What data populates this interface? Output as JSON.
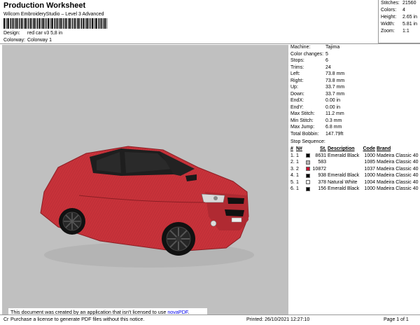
{
  "header": {
    "title": "Production Worksheet",
    "subtitle": "Wilcom EmbroideryStudio – Level 3 Advanced",
    "design_label": "Design:",
    "design_value": "red car v3 5,8 in",
    "colorway_label": "Colorway:",
    "colorway_value": "Colorway 1"
  },
  "summary": [
    {
      "k": "Stitches:",
      "v": "21560"
    },
    {
      "k": "Colors:",
      "v": "4"
    },
    {
      "k": "Height:",
      "v": "2.65 in"
    },
    {
      "k": "Width:",
      "v": "5.81 in"
    },
    {
      "k": "Zoom:",
      "v": "1:1"
    }
  ],
  "info": [
    {
      "k": "Machine:",
      "v": "Tajima"
    },
    {
      "k": "Color changes:",
      "v": "5"
    },
    {
      "k": "Stops:",
      "v": "6"
    },
    {
      "k": "Trims:",
      "v": "24"
    },
    {
      "k": "Left:",
      "v": "73.8 mm"
    },
    {
      "k": "Right:",
      "v": "73.8 mm"
    },
    {
      "k": "Up:",
      "v": "33.7 mm"
    },
    {
      "k": "Down:",
      "v": "33.7 mm"
    },
    {
      "k": "EndX:",
      "v": "0.00 in"
    },
    {
      "k": "EndY:",
      "v": "0.00 in"
    },
    {
      "k": "Max Stitch:",
      "v": "11.2 mm"
    },
    {
      "k": "Min Stitch:",
      "v": "0.3 mm"
    },
    {
      "k": "Max Jump:",
      "v": "6.8 mm"
    },
    {
      "k": "Total Bobbin:",
      "v": "147.79ft"
    }
  ],
  "stops": {
    "title": "Stop Sequence:",
    "headers": {
      "num": "#",
      "n": "N#",
      "st": "St.",
      "desc": "Description",
      "code": "Code",
      "brand": "Brand"
    },
    "rows": [
      {
        "num": "1.",
        "n": "1",
        "color": "#000000",
        "st": "8631",
        "desc": "Emerald Black",
        "code": "1000",
        "brand": "Madeira Classic 40"
      },
      {
        "num": "2.",
        "n": "1",
        "color": "#b4b4b4",
        "st": "583",
        "desc": "",
        "code": "1085",
        "brand": "Madeira Classic 40"
      },
      {
        "num": "3.",
        "n": "2",
        "color": "#c8102e",
        "st": "10872",
        "desc": "",
        "code": "1037",
        "brand": "Madeira Classic 40"
      },
      {
        "num": "4.",
        "n": "1",
        "color": "#000000",
        "st": "938",
        "desc": "Emerald Black",
        "code": "1000",
        "brand": "Madeira Classic 40"
      },
      {
        "num": "5.",
        "n": "1",
        "color": "#f0f0f0",
        "st": "378",
        "desc": "Natural White",
        "code": "1004",
        "brand": "Madeira Classic 40"
      },
      {
        "num": "6.",
        "n": "1",
        "color": "#000000",
        "st": "156",
        "desc": "Emerald Black",
        "code": "1000",
        "brand": "Madeira Classic 40"
      }
    ]
  },
  "notice": {
    "line1_prefix": "This document was created by an application that isn't licensed to use ",
    "link": "novaPDF",
    "line1_suffix": ".",
    "line2": "Purchase a license to generate PDF files without this notice."
  },
  "footer": {
    "cr": "Cr",
    "printed": "Printed: 26/10/2021 12:27:10",
    "page": "Page 1 of 1"
  }
}
